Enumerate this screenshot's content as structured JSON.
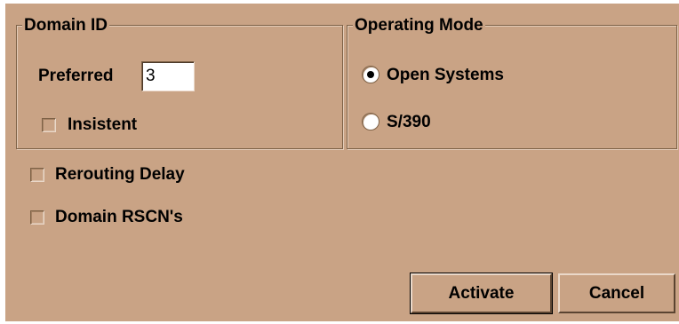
{
  "domain_id": {
    "title": "Domain ID",
    "preferred": {
      "label": "Preferred",
      "value": "3"
    },
    "insistent": {
      "label": "Insistent",
      "checked": false
    }
  },
  "operating_mode": {
    "title": "Operating Mode",
    "options": [
      {
        "label": "Open Systems",
        "selected": true
      },
      {
        "label": "S/390",
        "selected": false
      }
    ]
  },
  "options": {
    "rerouting_delay": {
      "label": "Rerouting Delay",
      "checked": false
    },
    "domain_rscns": {
      "label": "Domain RSCN's",
      "checked": false
    }
  },
  "buttons": {
    "activate": "Activate",
    "cancel": "Cancel"
  }
}
